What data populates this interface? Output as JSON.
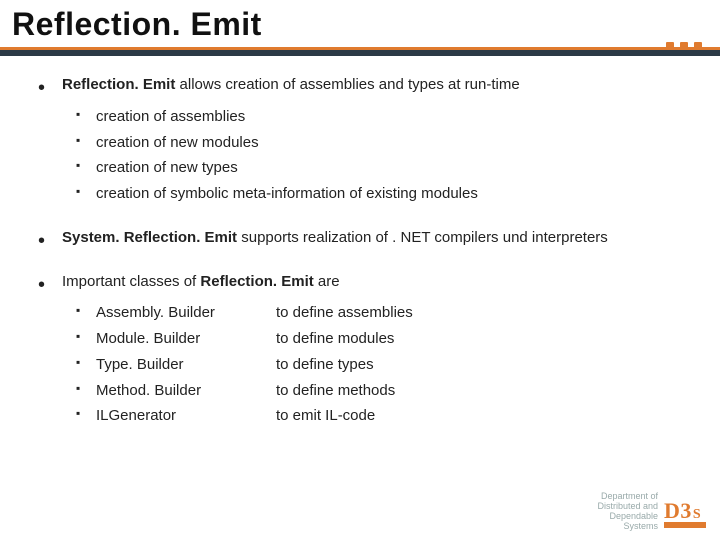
{
  "title": "Reflection. Emit",
  "bullets": [
    {
      "strong": "Reflection. Emit",
      "tail": " allows creation of assemblies and types at run-time",
      "sub": [
        "creation of assemblies",
        "creation of new modules",
        "creation of new types",
        "creation of symbolic meta-information of existing modules"
      ]
    },
    {
      "strong": "System. Reflection. Emit",
      "tail": " supports realization of . NET compilers und interpreters"
    },
    {
      "strong": "Important classes of ",
      "strong2": "Reflection. Emit",
      "tail": " are",
      "table": [
        {
          "name": "Assembly. Builder",
          "desc": "to define assemblies"
        },
        {
          "name": "Module. Builder",
          "desc": "to define modules"
        },
        {
          "name": "Type. Builder",
          "desc": "to define types"
        },
        {
          "name": "Method. Builder",
          "desc": "to define methods"
        },
        {
          "name": "ILGenerator",
          "desc": "to emit IL-code"
        }
      ]
    }
  ],
  "footer": {
    "dept_line1": "Department of",
    "dept_line2": "Distributed and",
    "dept_line3": "Dependable",
    "dept_line4": "Systems",
    "logo_d3": "D3",
    "logo_s": "S"
  }
}
